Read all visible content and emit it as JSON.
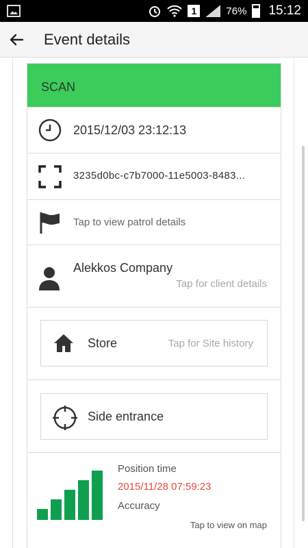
{
  "status_bar": {
    "battery": "76%",
    "time": "15:12",
    "sim": "1",
    "icons": [
      "gallery-icon",
      "alarm-icon",
      "wifi-icon",
      "sim-icon",
      "signal-icon",
      "battery-icon"
    ]
  },
  "appbar": {
    "title": "Event details",
    "back_icon": "arrow-left-icon"
  },
  "event": {
    "type": "SCAN",
    "timestamp": "2015/12/03 23:12:13",
    "scan_id": "3235d0bc-c7b7000-11e5003-8483...",
    "patrol_tap": "Tap to view patrol details",
    "client_name": "Alekkos Company",
    "client_tap": "Tap for client details",
    "site_name": "Store",
    "site_tap": "Tap for Site history",
    "location_name": "Side entrance",
    "position_time_label": "Position time",
    "position_time": "2015/11/28 07:59:23",
    "accuracy_label": "Accuracy",
    "accuracy_level": 1.0,
    "map_tap": "Tap to view on map"
  },
  "colors": {
    "scan_header": "#3ccc5c",
    "accuracy_bars": "#0f9f4f",
    "position_time": "#e34a3a"
  }
}
